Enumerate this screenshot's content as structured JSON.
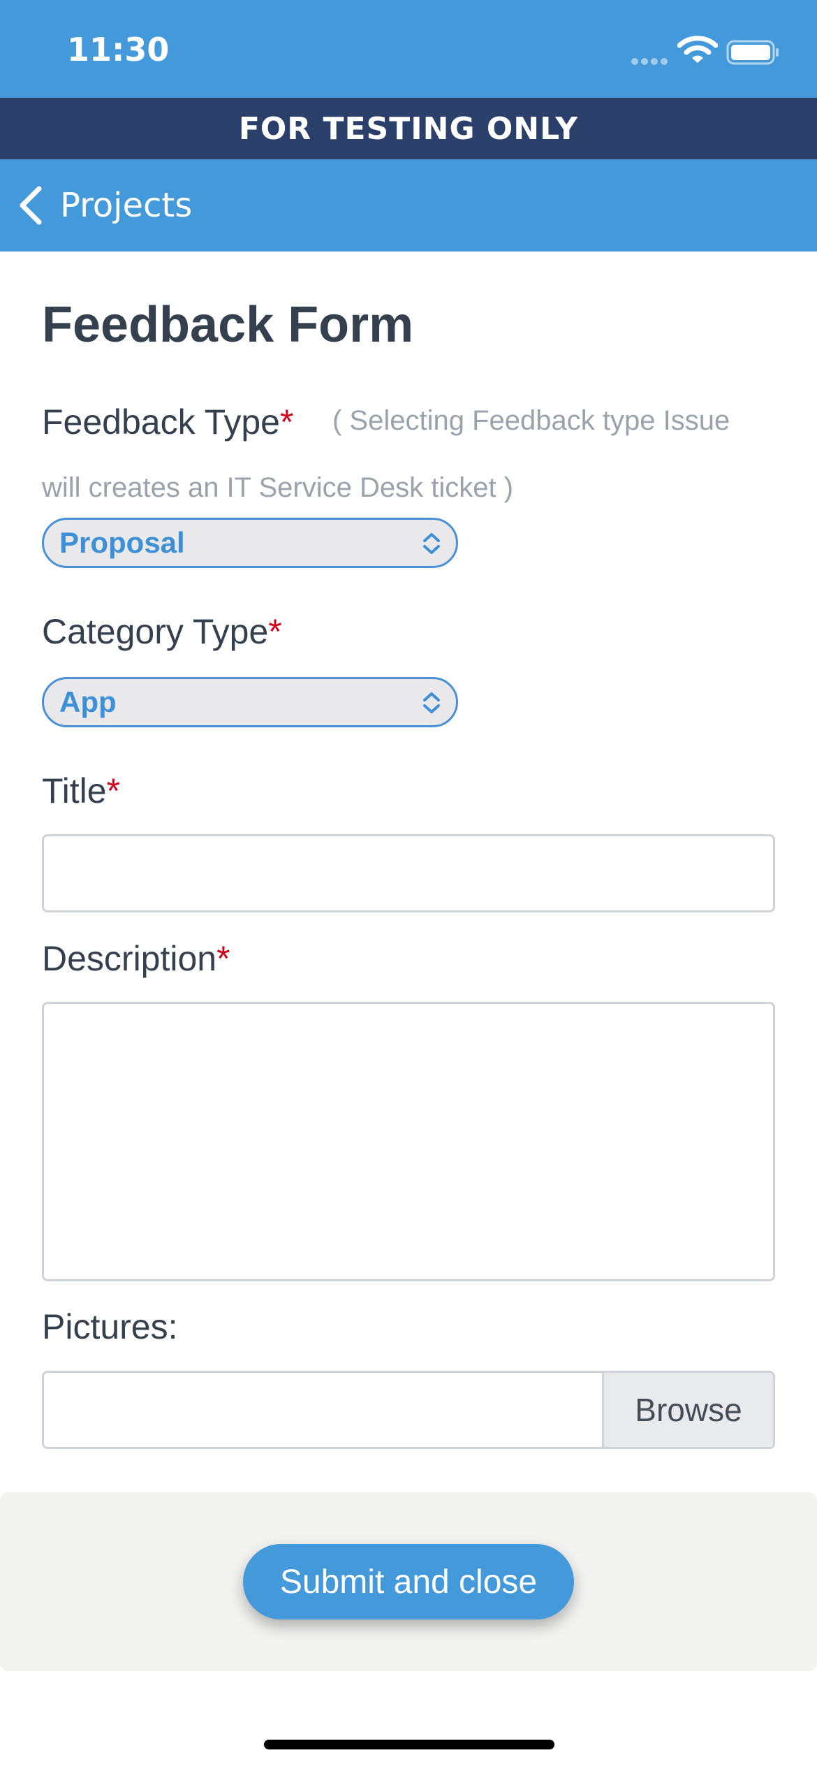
{
  "status_bar": {
    "time": "11:30",
    "icons": [
      "signal-dots-icon",
      "wifi-icon",
      "battery-icon"
    ]
  },
  "banner": {
    "text": "FOR TESTING ONLY"
  },
  "nav": {
    "back_label": "Projects",
    "back_icon": "chevron-left-icon"
  },
  "form": {
    "title": "Feedback Form",
    "required_marker": "*",
    "feedback_type": {
      "label": "Feedback Type",
      "hint_line1": "( Selecting Feedback type Issue",
      "hint_line2": "will creates an IT Service Desk ticket )",
      "selected": "Proposal"
    },
    "category_type": {
      "label": "Category Type",
      "selected": "App"
    },
    "title_field": {
      "label": "Title",
      "value": ""
    },
    "description_field": {
      "label": "Description",
      "value": ""
    },
    "pictures": {
      "label": "Pictures:",
      "browse_label": "Browse"
    }
  },
  "footer": {
    "submit_label": "Submit and close"
  },
  "colors": {
    "header_blue": "#4399d9",
    "banner_navy": "#2b3f6b",
    "required_red": "#d0021b",
    "accent_blue": "#3d8fd6"
  }
}
